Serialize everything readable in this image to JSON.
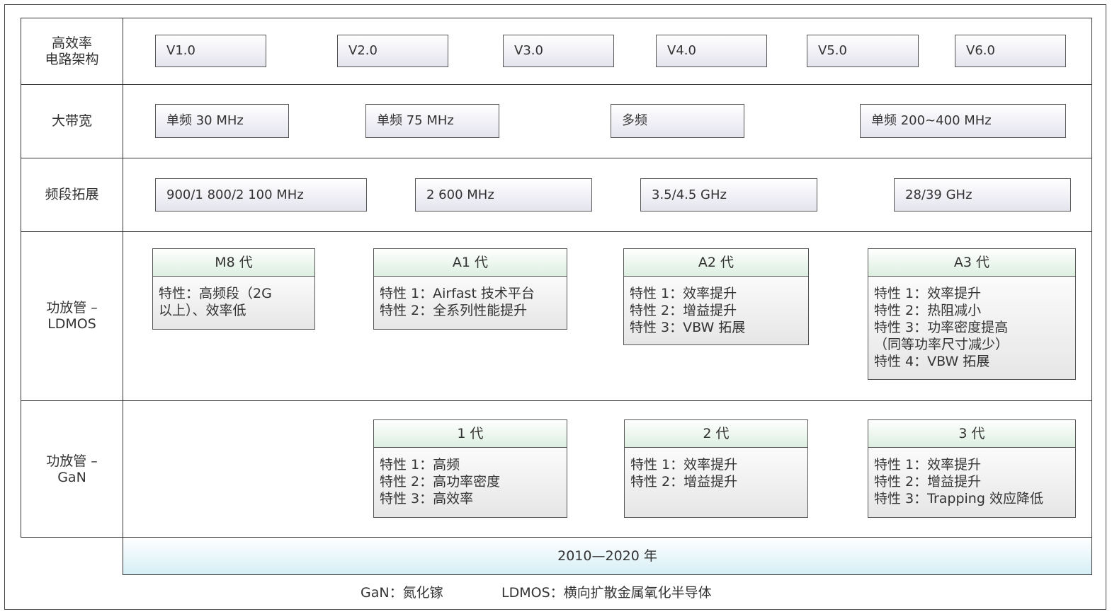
{
  "rows": {
    "circuit": [
      "高效率",
      "电路架构"
    ],
    "bandwidth": [
      "大带宽"
    ],
    "band": [
      "频段拓展"
    ],
    "ldmos": [
      "功放管 –",
      "LDMOS"
    ],
    "gan": [
      "功放管 –",
      "GaN"
    ]
  },
  "circuit_versions": [
    "V1.0",
    "V2.0",
    "V3.0",
    "V4.0",
    "V5.0",
    "V6.0"
  ],
  "bandwidth_items": [
    "单频 30 MHz",
    "单频 75 MHz",
    "多频",
    "单频 200~400 MHz"
  ],
  "band_items": [
    "900/1 800/2 100 MHz",
    "2 600 MHz",
    "3.5/4.5 GHz",
    "28/39 GHz"
  ],
  "ldmos_cards": [
    {
      "title": "M8 代",
      "lines": [
        "特性：高频段（2G",
        "以上）、效率低"
      ]
    },
    {
      "title": "A1 代",
      "lines": [
        "特性 1：Airfast 技术平台",
        "特性 2：全系列性能提升"
      ]
    },
    {
      "title": "A2 代",
      "lines": [
        "特性 1：效率提升",
        "特性 2：增益提升",
        "特性 3：VBW 拓展"
      ]
    },
    {
      "title": "A3 代",
      "lines": [
        "特性 1：效率提升",
        "特性 2：热阻减小",
        "特性 3：功率密度提高",
        "（同等功率尺寸减少）",
        "特性 4：VBW 拓展"
      ]
    }
  ],
  "gan_cards": [
    {
      "title": "1 代",
      "lines": [
        "特性 1：高频",
        "特性 2：高功率密度",
        "特性 3：高效率"
      ]
    },
    {
      "title": "2 代",
      "lines": [
        "特性 1：效率提升",
        "特性 2：增益提升"
      ]
    },
    {
      "title": "3 代",
      "lines": [
        "特性 1：效率提升",
        "特性 2：增益提升",
        "特性 3：Trapping 效应降低"
      ]
    }
  ],
  "timeline": "2010—2020 年",
  "legend": {
    "gan": "GaN：氮化镓",
    "ldmos": "LDMOS：横向扩散金属氧化半导体"
  }
}
